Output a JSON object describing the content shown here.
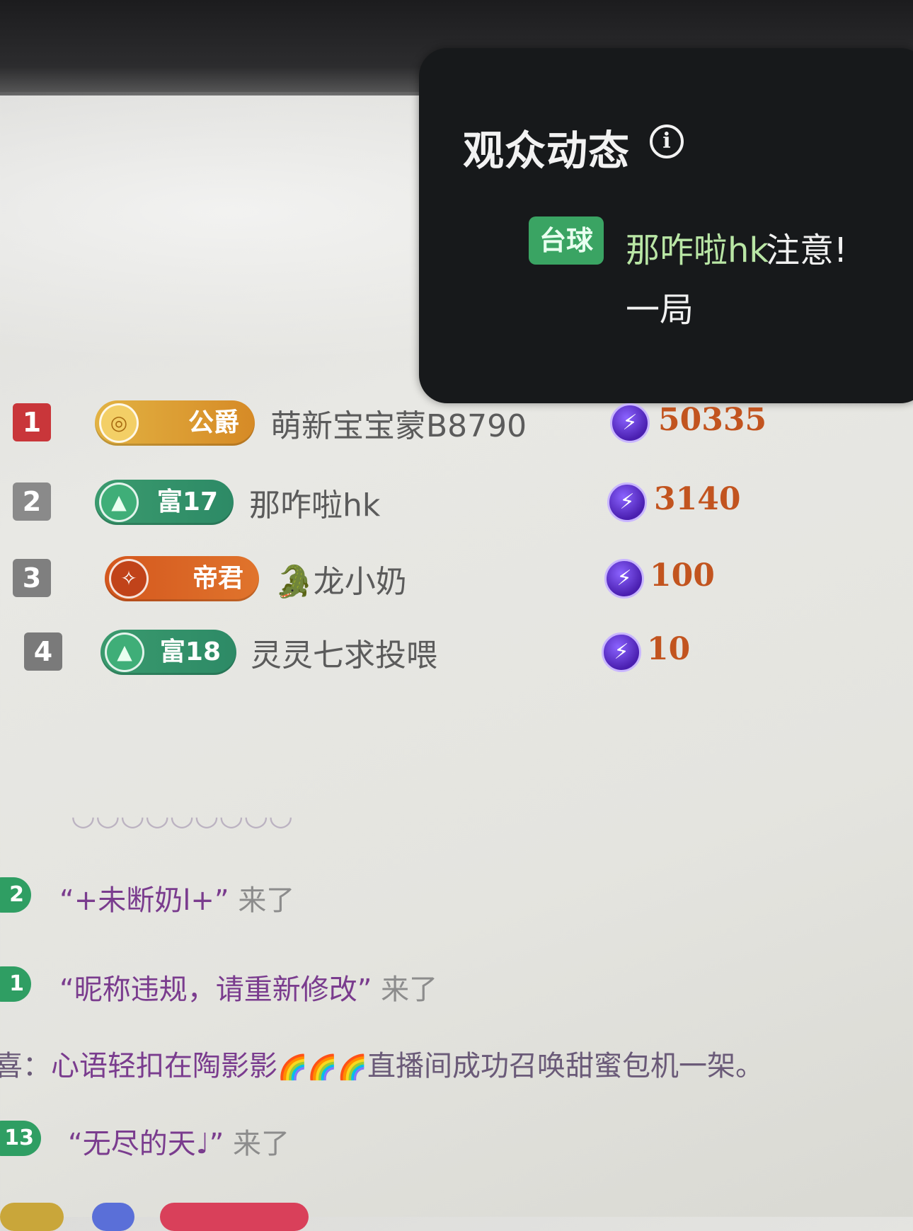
{
  "popup": {
    "title": "观众动态",
    "info_icon": "info-icon",
    "game_tag": "台球",
    "user": "那咋啦hk",
    "message": "注意!",
    "message_cont": "一局"
  },
  "ranking": [
    {
      "rank": "1",
      "badge": "公爵",
      "name": "萌新宝宝蒙B8790",
      "score": "50335"
    },
    {
      "rank": "2",
      "badge": "富17",
      "name": "那咋啦hk",
      "score": "3140"
    },
    {
      "rank": "3",
      "badge": "帝君",
      "name_icon": "🐊",
      "name": "龙小奶",
      "score": "100"
    },
    {
      "rank": "4",
      "badge": "富18",
      "name": "灵灵七求投喂",
      "score": "10"
    }
  ],
  "chat": [
    {
      "level": "2",
      "name": "“+未断奶l+”",
      "suffix": "来了"
    },
    {
      "level": "1",
      "name": "“昵称违规，请重新修改”",
      "suffix": "来了"
    },
    {
      "prefix": "喜：",
      "text": "心语轻扣在陶影影",
      "emojis": "🌈🌈🌈",
      "text2": "直播间成功召唤甜蜜包机一架。"
    },
    {
      "level": "13",
      "name": "“无尽的天♩”",
      "suffix": "来了"
    }
  ],
  "colors": {
    "popup_bg": "#17191b",
    "game_tag": "#3aa463",
    "score": "#c2541f",
    "level_badge": "#2f9e63"
  }
}
